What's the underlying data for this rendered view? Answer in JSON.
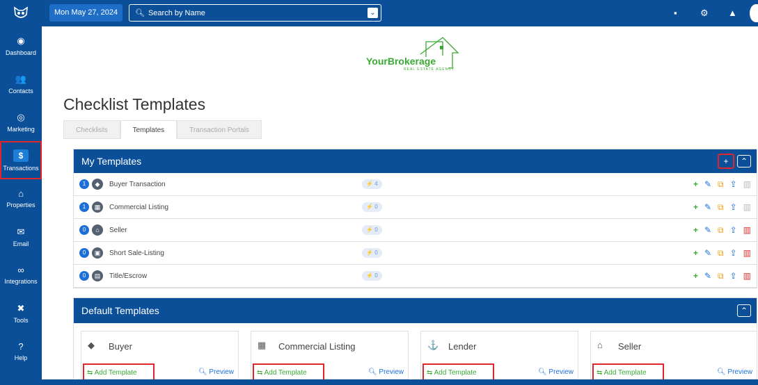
{
  "topbar": {
    "date": "Mon May 27, 2024",
    "search_placeholder": "Search by Name"
  },
  "sidebar": {
    "items": [
      {
        "label": "Dashboard",
        "icon": "dashboard-icon"
      },
      {
        "label": "Contacts",
        "icon": "contacts-icon"
      },
      {
        "label": "Marketing",
        "icon": "marketing-icon"
      },
      {
        "label": "Transactions",
        "icon": "dollar-icon",
        "active": true
      },
      {
        "label": "Properties",
        "icon": "home-icon"
      },
      {
        "label": "Email",
        "icon": "envelope-icon"
      },
      {
        "label": "Integrations",
        "icon": "link-icon"
      },
      {
        "label": "Tools",
        "icon": "tools-icon"
      },
      {
        "label": "Help",
        "icon": "help-icon"
      }
    ]
  },
  "brand": {
    "name": "YourBrokerage",
    "tagline": "REAL ESTATE AGENCY"
  },
  "page": {
    "title": "Checklist Templates",
    "tabs": [
      "Checklists",
      "Templates",
      "Transaction Portals"
    ],
    "active_tab": "Templates"
  },
  "my_templates": {
    "title": "My Templates",
    "rows": [
      {
        "count": "1",
        "name": "Buyer Transaction",
        "tasks": "4",
        "deletable": false
      },
      {
        "count": "1",
        "name": "Commercial Listing",
        "tasks": "0",
        "deletable": false
      },
      {
        "count": "0",
        "name": "Seller",
        "tasks": "0",
        "deletable": true
      },
      {
        "count": "0",
        "name": "Short Sale-Listing",
        "tasks": "0",
        "deletable": true
      },
      {
        "count": "0",
        "name": "Title/Escrow",
        "tasks": "0",
        "deletable": true
      }
    ]
  },
  "default_templates": {
    "title": "Default Templates",
    "cards": [
      {
        "name": "Buyer",
        "add_label": "Add Template",
        "preview_label": "Preview"
      },
      {
        "name": "Commercial Listing",
        "add_label": "Add Template",
        "preview_label": "Preview"
      },
      {
        "name": "Lender",
        "add_label": "Add Template",
        "preview_label": "Preview"
      },
      {
        "name": "Seller",
        "add_label": "Add Template",
        "preview_label": "Preview"
      }
    ]
  },
  "colors": {
    "nav_blue": "#0a4f98",
    "accent_green": "#3aaa35",
    "highlight_red": "#e0262a"
  }
}
